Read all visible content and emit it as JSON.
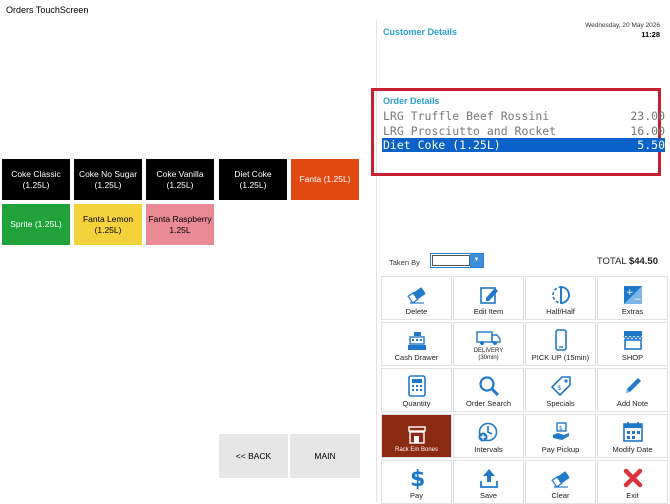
{
  "window": {
    "title": "Orders TouchScreen"
  },
  "products": [
    {
      "line1": "Coke Classic",
      "line2": "(1.25L)",
      "bg": "#000000",
      "fg": "#ffffff"
    },
    {
      "line1": "Coke No Sugar",
      "line2": "(1.25L)",
      "bg": "#000000",
      "fg": "#ffffff"
    },
    {
      "line1": "Coke Vanilla",
      "line2": "(1.25L)",
      "bg": "#000000",
      "fg": "#ffffff"
    },
    {
      "line1": "Diet Coke",
      "line2": "(1.25L)",
      "bg": "#000000",
      "fg": "#ffffff"
    },
    {
      "line1": "Fanta (1.25L)",
      "line2": "",
      "bg": "#e04a12",
      "fg": "#ffffff"
    },
    {
      "line1": "Sprite (1.25L)",
      "line2": "",
      "bg": "#21a13a",
      "fg": "#ffffff"
    },
    {
      "line1": "Fanta Lemon",
      "line2": "(1.25L)",
      "bg": "#f4d23c",
      "fg": "#000000"
    },
    {
      "line1": "Fanta Raspberry",
      "line2": "1.25L",
      "bg": "#ea8a94",
      "fg": "#000000"
    }
  ],
  "nav": {
    "back": "<< BACK",
    "main": "MAIN"
  },
  "customer": {
    "title": "Customer Details",
    "date": "Wednesday, 20 May 2026",
    "time": "11:28"
  },
  "order": {
    "title": "Order Details",
    "items": [
      {
        "name": "LRG Truffle Beef Rossini",
        "price": "23.00"
      },
      {
        "name": "LRG Prosciutto and Rocket",
        "price": "16.00"
      },
      {
        "name": "Diet Coke (1.25L)",
        "price": "5.50",
        "selected": true
      }
    ]
  },
  "taken_by": {
    "label": "Taken By",
    "value": ""
  },
  "total": {
    "label": "TOTAL",
    "value": "$44.50"
  },
  "functions": [
    {
      "label": "Delete",
      "icon": "eraser-icon"
    },
    {
      "label": "Edit Item",
      "icon": "edit-icon"
    },
    {
      "label": "Half/Half",
      "icon": "half-circle-icon"
    },
    {
      "label": "Extras",
      "icon": "plus-minus-icon"
    },
    {
      "label": "Cash Drawer",
      "icon": "cash-register-icon"
    },
    {
      "label": "DELIVERY",
      "sub": "(30min)",
      "icon": "truck-icon"
    },
    {
      "label": "PICK UP (15min)",
      "icon": "phone-icon"
    },
    {
      "label": "SHOP",
      "icon": "shop-icon"
    },
    {
      "label": "Quantity",
      "icon": "calculator-icon"
    },
    {
      "label": "Order Search",
      "icon": "search-icon"
    },
    {
      "label": "Specials",
      "icon": "tag-icon"
    },
    {
      "label": "Add Note",
      "icon": "pencil-icon"
    },
    {
      "label": "Rack Em Bones",
      "icon": "store-icon"
    },
    {
      "label": "Intervals",
      "icon": "clock-plus-icon"
    },
    {
      "label": "Pay Pickup",
      "icon": "hand-money-icon"
    },
    {
      "label": "Modify Date",
      "icon": "calendar-icon"
    },
    {
      "label": "Pay",
      "icon": "dollar-icon"
    },
    {
      "label": "Save",
      "icon": "upload-icon"
    },
    {
      "label": "Clear",
      "icon": "eraser-icon"
    },
    {
      "label": "Exit",
      "icon": "close-icon"
    }
  ],
  "colors": {
    "accent": "#2aa1c9",
    "selection": "#0a62c9",
    "highlight_border": "#c8202f",
    "icon_blue": "#1f78c8",
    "brown": "#8a2a12"
  }
}
